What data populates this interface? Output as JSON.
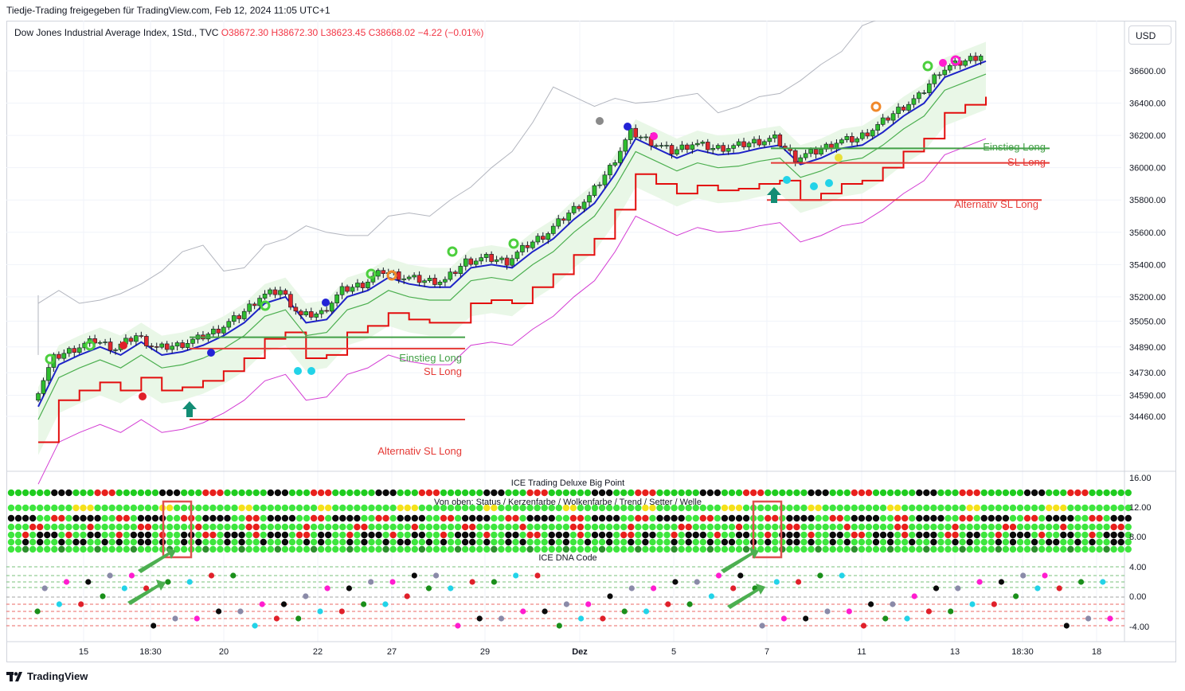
{
  "header": {
    "publisher_text": "Tiedje-Trading freigegeben für TradingView.com, Feb 12, 2024 11:05 UTC+1",
    "symbol_text": "Dow Jones Industrial Average Index, 1Std., TVC",
    "ohlc": {
      "O": "O38672.30",
      "H": "H38672.30",
      "L": "L38623.45",
      "C": "C38668.02",
      "change": "−4.22 (−0.01%)"
    },
    "currency": "USD",
    "logo_text": "TradingView"
  },
  "colors": {
    "up": "#26a69a",
    "down": "#f23645",
    "green_line": "#4caf50",
    "blue_line": "#1e22c8",
    "red_line": "#e30d0d",
    "magenta_line": "#d33bd3",
    "gray_line": "#b2b5be",
    "cloud": "#e9f7e7"
  },
  "chart_data": [
    {
      "type": "line",
      "title": "Dow Jones Industrial Average Index, 1Std., TVC",
      "y_ticks": [
        "36600.00",
        "36400.00",
        "36200.00",
        "36000.00",
        "35800.00",
        "35600.00",
        "35400.00",
        "35200.00",
        "35050.00",
        "34890.00",
        "34730.00",
        "34590.00",
        "34460.00"
      ],
      "x_ticks": [
        "15",
        "18:30",
        "20",
        "22",
        "27",
        "29",
        "Dez",
        "5",
        "7",
        "11",
        "13",
        "18:30",
        "18"
      ],
      "annotations": [
        "Einstieg Long",
        "SL Long",
        "Alternativ SL Long",
        "Einstieg Long",
        "SL Long",
        "Alternativ SL Long"
      ],
      "series": [
        {
          "name": "price",
          "points": [
            [
              0,
              34560
            ],
            [
              4,
              34820
            ],
            [
              8,
              34880
            ],
            [
              12,
              34930
            ],
            [
              16,
              34880
            ],
            [
              20,
              34960
            ],
            [
              24,
              34880
            ],
            [
              28,
              34900
            ],
            [
              32,
              34940
            ],
            [
              36,
              35000
            ],
            [
              40,
              35080
            ],
            [
              44,
              35200
            ],
            [
              48,
              35240
            ],
            [
              52,
              35080
            ],
            [
              56,
              35100
            ],
            [
              60,
              35240
            ],
            [
              64,
              35280
            ],
            [
              68,
              35360
            ],
            [
              72,
              35320
            ],
            [
              76,
              35300
            ],
            [
              80,
              35300
            ],
            [
              84,
              35420
            ],
            [
              88,
              35440
            ],
            [
              92,
              35420
            ],
            [
              96,
              35520
            ],
            [
              100,
              35600
            ],
            [
              104,
              35720
            ],
            [
              108,
              35820
            ],
            [
              112,
              36000
            ],
            [
              116,
              36220
            ],
            [
              120,
              36160
            ],
            [
              124,
              36100
            ],
            [
              128,
              36150
            ],
            [
              132,
              36120
            ],
            [
              136,
              36130
            ],
            [
              140,
              36160
            ],
            [
              144,
              36180
            ],
            [
              148,
              36060
            ],
            [
              152,
              36100
            ],
            [
              156,
              36160
            ],
            [
              160,
              36180
            ],
            [
              164,
              36260
            ],
            [
              168,
              36360
            ],
            [
              172,
              36440
            ],
            [
              176,
              36600
            ],
            [
              180,
              36650
            ],
            [
              184,
              36700
            ]
          ]
        }
      ]
    },
    {
      "type": "scatter",
      "title": "ICE Trading Deluxe Big Point",
      "subtitle": "Von oben: Status / Kerzenfarbe / Wolkenfarbe / Trend / Setter / Welle",
      "y_ticks": [
        "16.00",
        "12.00",
        "8.00"
      ]
    },
    {
      "type": "scatter",
      "title": "ICE DNA Code",
      "y_ticks": [
        "4.00",
        "0.00",
        "-4.00"
      ]
    }
  ]
}
